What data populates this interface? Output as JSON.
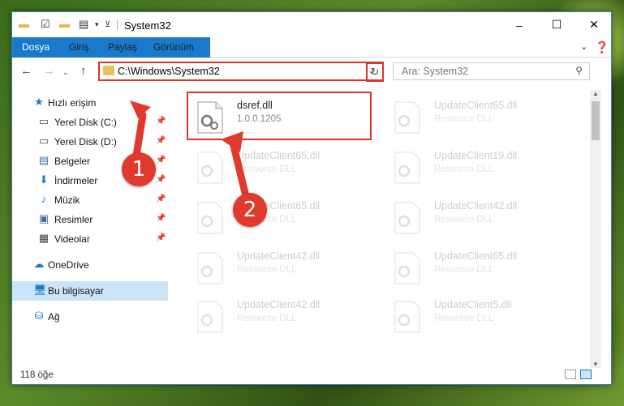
{
  "window": {
    "title": "System32",
    "controls": {
      "minimize": "–",
      "maximize": "☐",
      "close": "✕"
    }
  },
  "ribbon": {
    "tabs": [
      "Dosya",
      "Giriş",
      "Paylaş",
      "Görünüm"
    ]
  },
  "nav": {
    "address": "C:\\Windows\\System32",
    "search_placeholder": "Ara: System32"
  },
  "sidebar": {
    "items": [
      {
        "label": "Hızlı erişim",
        "icon": "star-icon",
        "pinned": false
      },
      {
        "label": "Yerel Disk (C:)",
        "icon": "drive-icon",
        "pinned": true
      },
      {
        "label": "Yerel Disk (D:)",
        "icon": "drive-icon",
        "pinned": true
      },
      {
        "label": "Belgeler",
        "icon": "documents-icon",
        "pinned": true
      },
      {
        "label": "İndirmeler",
        "icon": "download-icon",
        "pinned": true
      },
      {
        "label": "Müzik",
        "icon": "music-icon",
        "pinned": true
      },
      {
        "label": "Resimler",
        "icon": "pictures-icon",
        "pinned": true
      },
      {
        "label": "Videolar",
        "icon": "video-icon",
        "pinned": true
      },
      {
        "label": "OneDrive",
        "icon": "cloud-icon",
        "pinned": false
      },
      {
        "label": "Bu bilgisayar",
        "icon": "computer-icon",
        "pinned": false,
        "selected": true
      },
      {
        "label": "Ağ",
        "icon": "network-icon",
        "pinned": false
      }
    ]
  },
  "files": [
    {
      "name": "dsref.dll",
      "desc": "1.0.0.1205",
      "highlighted": true
    },
    {
      "name": "UpdateClient65.dll",
      "desc": "Resource DLL"
    },
    {
      "name": "UpdateClient65.dll",
      "desc": "Resource DLL"
    },
    {
      "name": "UpdateClient19.dll",
      "desc": "Resource DLL"
    },
    {
      "name": "UpdateClient65.dll",
      "desc": "Resource DLL"
    },
    {
      "name": "UpdateClient42.dll",
      "desc": "Resource DLL"
    },
    {
      "name": "UpdateClient42.dll",
      "desc": "Resource DLL"
    },
    {
      "name": "UpdateClient65.dll",
      "desc": "Resource DLL"
    },
    {
      "name": "UpdateClient42.dll",
      "desc": "Resource DLL"
    },
    {
      "name": "UpdateClient5.dll",
      "desc": "Resource DLL"
    }
  ],
  "status": {
    "count": "118 öğe"
  },
  "annotations": {
    "step1": "1",
    "step2": "2"
  },
  "colors": {
    "accent": "#1979ca",
    "highlight": "#d9362a",
    "selected": "#cce4f7"
  }
}
